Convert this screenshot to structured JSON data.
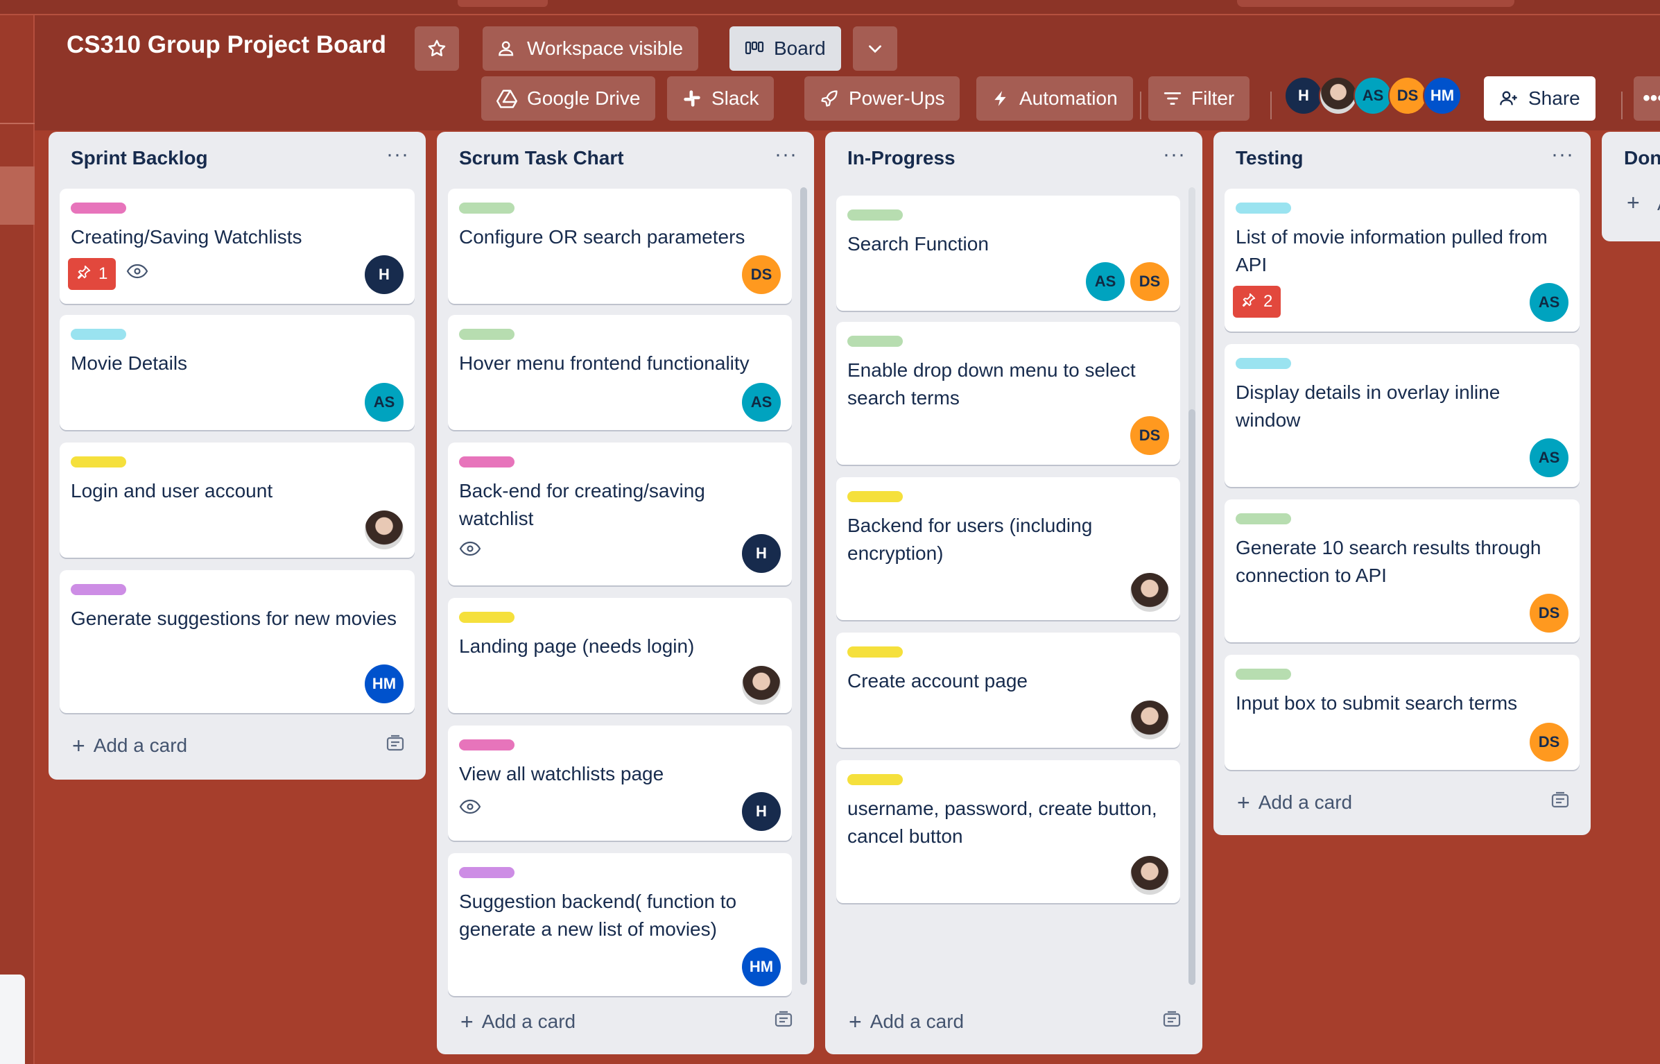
{
  "board": {
    "title": "CS310 Group Project Board",
    "visibility_label": "Workspace visible",
    "view_label": "Board",
    "google_drive_label": "Google Drive",
    "slack_label": "Slack",
    "powerups_label": "Power-Ups",
    "automation_label": "Automation",
    "filter_label": "Filter",
    "share_label": "Share"
  },
  "members": [
    {
      "initials": "H",
      "color": "#172b4d"
    },
    {
      "initials": "",
      "color": "photo"
    },
    {
      "initials": "AS",
      "color": "#00a3bf"
    },
    {
      "initials": "DS",
      "color": "#ff991f"
    },
    {
      "initials": "HM",
      "color": "#0052cc"
    }
  ],
  "label_colors": {
    "pink": "#e774bb",
    "cyan": "#9ae3f0",
    "yellow": "#f5e03c",
    "purple": "#cd8de5",
    "green": "#b7ddb0"
  },
  "lists": [
    {
      "title": "Sprint Backlog",
      "add_label": "Add a card",
      "cards": [
        {
          "label": "pink",
          "title": "Creating/Saving Watchlists",
          "badge": "1",
          "watch": true,
          "member": "H"
        },
        {
          "label": "cyan",
          "title": "Movie Details",
          "member": "AS"
        },
        {
          "label": "yellow",
          "title": "Login and user account",
          "member": "photo"
        },
        {
          "label": "purple",
          "title": "Generate suggestions for new movies",
          "member": "HM"
        }
      ]
    },
    {
      "title": "Scrum Task Chart",
      "add_label": "Add a card",
      "cards": [
        {
          "label": "green",
          "title": "Configure OR search parameters",
          "member": "DS"
        },
        {
          "label": "green",
          "title": "Hover menu frontend functionality",
          "member": "AS"
        },
        {
          "label": "pink",
          "title": "Back-end for creating/saving watchlist",
          "watch": true,
          "member": "H"
        },
        {
          "label": "yellow",
          "title": "Landing page (needs login)",
          "member": "photo"
        },
        {
          "label": "pink",
          "title": "View all watchlists page",
          "watch": true,
          "member": "H"
        },
        {
          "label": "purple",
          "title": "Suggestion backend( function to generate a new list of movies)",
          "member": "HM"
        }
      ]
    },
    {
      "title": "In-Progress",
      "add_label": "Add a card",
      "cards": [
        {
          "label": "green",
          "title": "Search Function",
          "members": [
            "AS",
            "DS"
          ]
        },
        {
          "label": "green",
          "title": "Enable drop down menu to select search terms",
          "member": "DS"
        },
        {
          "label": "yellow",
          "title": "Backend for users (including encryption)",
          "member": "photo"
        },
        {
          "label": "yellow",
          "title": "Create account page",
          "member": "photo"
        },
        {
          "label": "yellow",
          "title": "username, password, create button, cancel button",
          "member": "photo"
        }
      ]
    },
    {
      "title": "Testing",
      "add_label": "Add a card",
      "cards": [
        {
          "label": "cyan",
          "title": "List of movie information pulled from API",
          "badge": "2",
          "member": "AS"
        },
        {
          "label": "cyan",
          "title": "Display details in overlay inline window",
          "member": "AS"
        },
        {
          "label": "green",
          "title": "Generate 10 search results through connection to API",
          "member": "DS"
        },
        {
          "label": "green",
          "title": "Input box to submit search terms",
          "member": "DS"
        }
      ]
    },
    {
      "title": "Don",
      "add_label": "A"
    }
  ]
}
